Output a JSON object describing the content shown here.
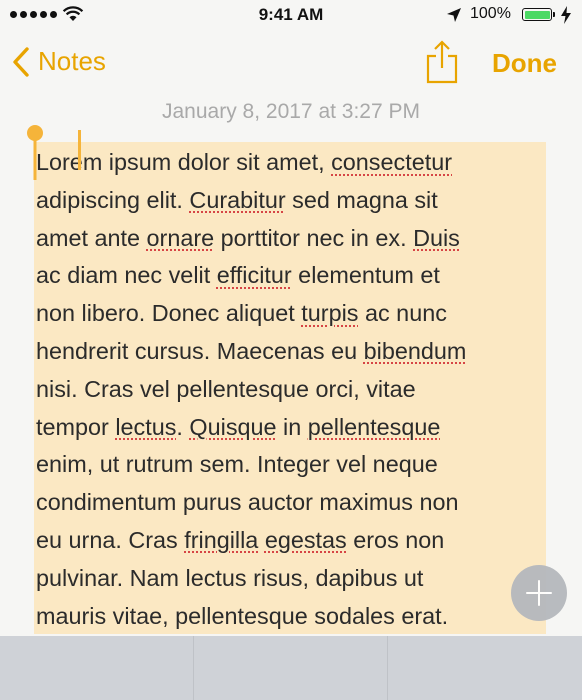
{
  "status_bar": {
    "time": "9:41 AM",
    "battery_percent": "100%",
    "battery_level": 1.0,
    "signal_bars": 5
  },
  "nav": {
    "back_label": "Notes",
    "done_label": "Done",
    "accent_color": "#e8a400"
  },
  "note": {
    "date": "January 8, 2017 at 3:27 PM",
    "selection_color": "#fbe8c3",
    "lines": [
      [
        {
          "t": "Lorem ipsum dolor sit amet, "
        },
        {
          "t": "consectetur",
          "m": true
        }
      ],
      [
        {
          "t": "adipiscing elit. "
        },
        {
          "t": "Curabitur",
          "m": true
        },
        {
          "t": " sed magna sit"
        }
      ],
      [
        {
          "t": "amet ante "
        },
        {
          "t": "ornare",
          "m": true
        },
        {
          "t": " porttitor nec in ex. "
        },
        {
          "t": "Duis",
          "m": true
        }
      ],
      [
        {
          "t": "ac diam nec velit "
        },
        {
          "t": "efficitur",
          "m": true
        },
        {
          "t": " elementum et"
        }
      ],
      [
        {
          "t": "non libero. Donec aliquet "
        },
        {
          "t": "turpis",
          "m": true
        },
        {
          "t": " ac nunc"
        }
      ],
      [
        {
          "t": "hendrerit cursus. Maecenas eu "
        },
        {
          "t": "bibendum",
          "m": true
        }
      ],
      [
        {
          "t": "nisi. Cras vel pellentesque orci, vitae"
        }
      ],
      [
        {
          "t": "tempor "
        },
        {
          "t": "lectus",
          "m": true
        },
        {
          "t": ". "
        },
        {
          "t": "Quisque",
          "m": true
        },
        {
          "t": " in "
        },
        {
          "t": "pellentesque",
          "m": true
        }
      ],
      [
        {
          "t": "enim, ut rutrum sem. Integer vel neque"
        }
      ],
      [
        {
          "t": "condimentum purus auctor maximus non"
        }
      ],
      [
        {
          "t": "eu urna. Cras "
        },
        {
          "t": "fringilla",
          "m": true
        },
        {
          "t": " "
        },
        {
          "t": "egestas",
          "m": true
        },
        {
          "t": " eros non"
        }
      ],
      [
        {
          "t": "pulvinar. Nam lectus risus, dapibus ut"
        }
      ],
      [
        {
          "t": "mauris vitae, pellentesque sodales erat."
        }
      ]
    ]
  },
  "icons": {
    "back": "chevron-left-icon",
    "share": "share-icon",
    "add": "plus-icon",
    "location": "location-arrow-icon",
    "charging": "charging-bolt-icon"
  }
}
